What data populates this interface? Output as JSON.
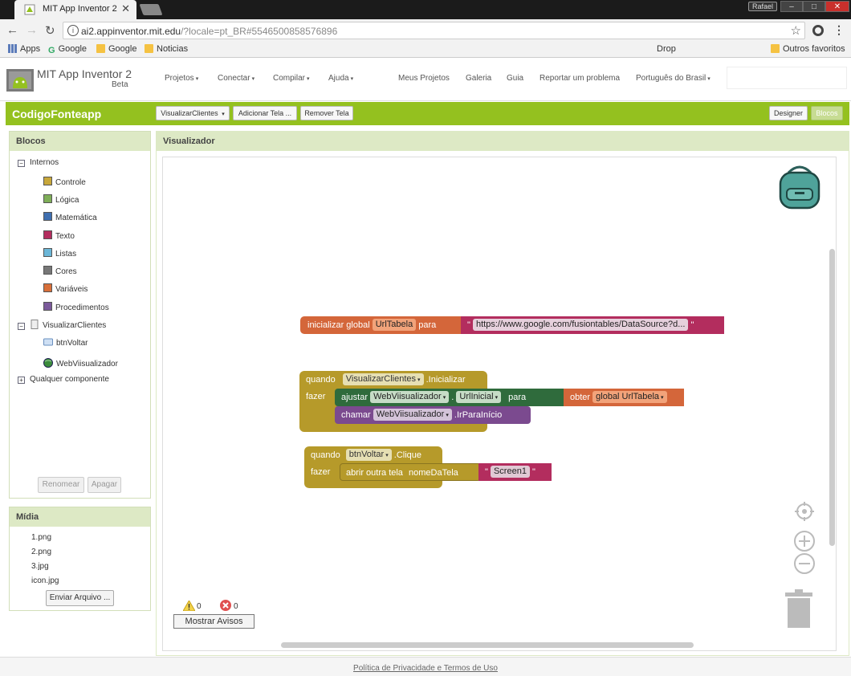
{
  "browser": {
    "tab_title": "MIT App Inventor 2",
    "tab_close": "✕",
    "profile": "Rafael",
    "url_host": "ai2.appinventor.mit.edu",
    "url_rest": "/?locale=pt_BR#5546500858576896",
    "bookmarks": {
      "apps": "Apps",
      "google1": "Google",
      "google2": "Google",
      "noticias": "Noticias",
      "drop": "Drop",
      "outros": "Outros favoritos"
    }
  },
  "header": {
    "brand": "MIT App Inventor 2",
    "beta": "Beta",
    "menus": [
      "Projetos",
      "Conectar",
      "Compilar",
      "Ajuda"
    ],
    "links": [
      "Meus Projetos",
      "Galeria",
      "Guia",
      "Reportar um problema"
    ],
    "language": "Português do Brasil"
  },
  "projectbar": {
    "name": "CodigoFonteapp",
    "screen_select": "VisualizarClientes",
    "add_screen": "Adicionar Tela ...",
    "remove_screen": "Remover Tela",
    "designer": "Designer",
    "blocks": "Blocos"
  },
  "blocks_panel": {
    "title": "Blocos",
    "builtin": "Internos",
    "categories": [
      {
        "label": "Controle",
        "color": "#c8a73a"
      },
      {
        "label": "Lógica",
        "color": "#7fae58"
      },
      {
        "label": "Matemática",
        "color": "#3f6fb0"
      },
      {
        "label": "Texto",
        "color": "#b32d5e"
      },
      {
        "label": "Listas",
        "color": "#6cb7d8"
      },
      {
        "label": "Cores",
        "color": "#777777"
      },
      {
        "label": "Variáveis",
        "color": "#d86f3a"
      },
      {
        "label": "Procedimentos",
        "color": "#7b5a9b"
      }
    ],
    "screen": "VisualizarClientes",
    "components": [
      "btnVoltar",
      "WebViisualizador"
    ],
    "any_component": "Qualquer componente",
    "rename": "Renomear",
    "delete": "Apagar"
  },
  "media": {
    "title": "Mídia",
    "files": [
      "1.png",
      "2.png",
      "3.jpg",
      "icon.jpg"
    ],
    "upload": "Enviar Arquivo ..."
  },
  "viewer": {
    "title": "Visualizador",
    "warnings": "0",
    "errors": "0",
    "show_warnings": "Mostrar Avisos"
  },
  "code": {
    "global_init": {
      "kw": "inicializar global",
      "name": "UrlTabela",
      "to": "para",
      "url": "https://www.google.com/fusiontables/DataSource?d..."
    },
    "event1": {
      "when": "quando",
      "component": "VisualizarClientes",
      "event": ".Inicializar",
      "do": "fazer",
      "set": "ajustar",
      "set_component": "WebViisualizador",
      "set_prop": "UrlInicial",
      "set_to": "para",
      "get": "obter",
      "get_var": "global UrlTabela",
      "call": "chamar",
      "call_component": "WebViisualizador",
      "call_method": ".IrParaInício"
    },
    "event2": {
      "when": "quando",
      "component": "btnVoltar",
      "event": ".Clique",
      "do": "fazer",
      "open": "abrir outra tela",
      "param": "nomeDaTela",
      "screen": "Screen1"
    }
  },
  "footer": "Política de Privacidade e Termos de Uso"
}
